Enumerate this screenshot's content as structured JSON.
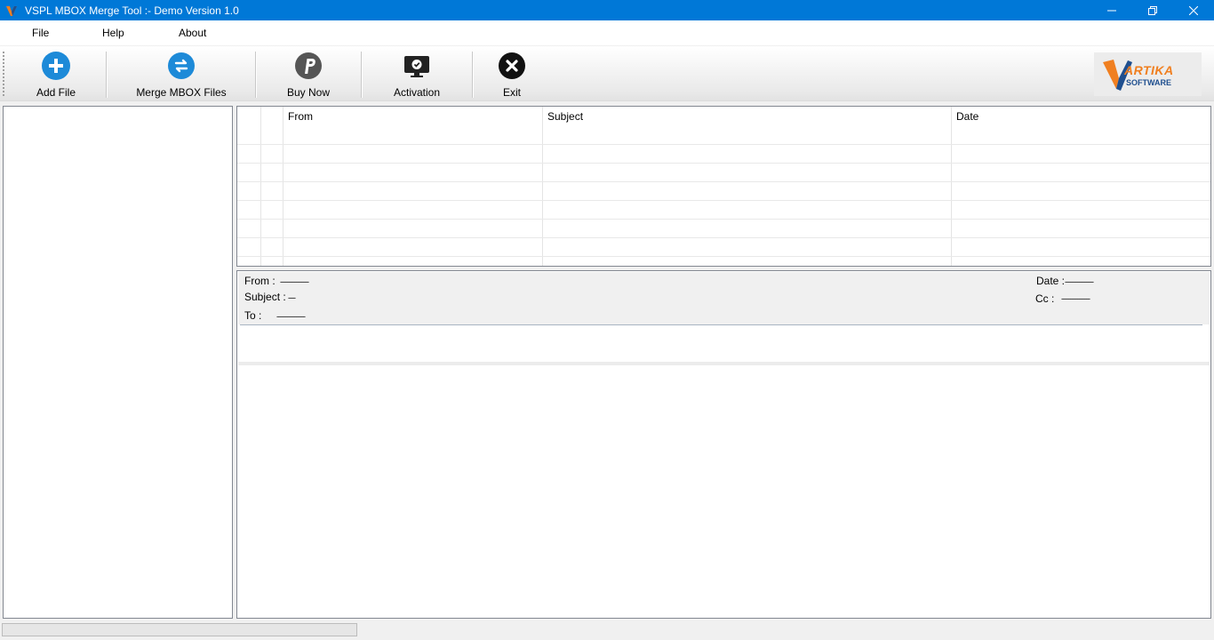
{
  "window": {
    "title": "VSPL MBOX Merge Tool  :- Demo Version 1.0",
    "minimize_glyph": "—",
    "maximize_glyph": "❐",
    "close_glyph": "✕"
  },
  "menu": {
    "file": "File",
    "help": "Help",
    "about": "About"
  },
  "toolbar": {
    "add_file": "Add File",
    "merge": "Merge MBOX Files",
    "buy_now": "Buy Now",
    "activation": "Activation",
    "exit": "Exit"
  },
  "logo": {
    "line1": "ARTIKA",
    "line2": "SOFTWARE"
  },
  "colors": {
    "titlebar": "#0078d7",
    "add_icon": "#1d8ad8",
    "merge_icon": "#1d8ad8",
    "buy_icon": "#555555",
    "activation_icon": "#222222",
    "exit_icon": "#111111",
    "logo_orange": "#f07f20",
    "logo_blue": "#1f4f8f"
  },
  "email_list": {
    "columns": [
      "",
      "",
      "From",
      "Subject",
      "Date"
    ],
    "rows": []
  },
  "preview": {
    "from_label": "From :",
    "from_value": "----------------",
    "subject_label": "Subject :",
    "subject_value": "----",
    "to_label": "To :",
    "to_value": "----------------",
    "date_label": "Date :",
    "date_value": "----------------",
    "cc_label": "Cc :",
    "cc_value": "----------------"
  },
  "status": {
    "progress": 0
  }
}
